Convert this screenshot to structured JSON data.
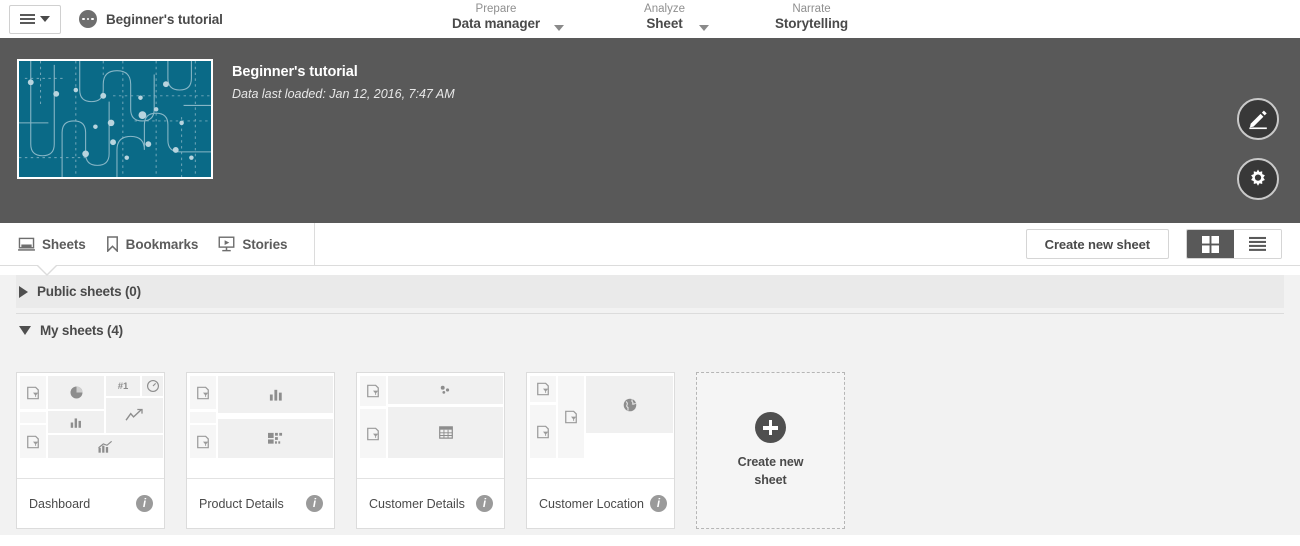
{
  "topnav": {
    "burger_icon": "hamburger-menu-icon",
    "burger_caret_icon": "chevron-down-icon",
    "app_dots_icon": "app-dots-icon",
    "app_label": "Beginner's tutorial",
    "groups": [
      {
        "kicker": "Prepare",
        "title": "Data manager",
        "has_chevron": true
      },
      {
        "kicker": "Analyze",
        "title": "Sheet",
        "has_chevron": true
      },
      {
        "kicker": "Narrate",
        "title": "Storytelling",
        "has_chevron": false
      }
    ]
  },
  "appheader": {
    "thumbnail_alt": "app-thumbnail",
    "thumbnail_color": "#0a6a87",
    "title": "Beginner's tutorial",
    "subtitle": "Data last loaded: Jan 12, 2016, 7:47 AM",
    "edit_icon": "pencil-icon",
    "settings_icon": "gear-icon",
    "background_color": "#595959"
  },
  "tabbar": {
    "tabs": [
      {
        "label": "Sheets",
        "icon": "sheet-icon",
        "active": true
      },
      {
        "label": "Bookmarks",
        "icon": "bookmark-icon",
        "active": false
      },
      {
        "label": "Stories",
        "icon": "story-icon",
        "active": false
      }
    ],
    "create_sheet_label": "Create new sheet",
    "view_grid_icon": "grid-view-icon",
    "view_list_icon": "list-view-icon",
    "active_view": "grid"
  },
  "content": {
    "sections": [
      {
        "label": "Public sheets (0)",
        "expanded": false,
        "toggle_icon": "triangle-right-icon"
      },
      {
        "label": "My sheets (4)",
        "expanded": true,
        "toggle_icon": "triangle-down-icon"
      }
    ],
    "sheets": [
      {
        "title": "Dashboard",
        "info_icon": "info-icon",
        "layout": "dashboard"
      },
      {
        "title": "Product Details",
        "info_icon": "info-icon",
        "layout": "product"
      },
      {
        "title": "Customer Details",
        "info_icon": "info-icon",
        "layout": "customer"
      },
      {
        "title": "Customer Location",
        "info_icon": "info-icon",
        "layout": "location"
      }
    ],
    "create_tile": {
      "label_line1": "Create new",
      "label_line2": "sheet",
      "plus_icon": "plus-circle-icon"
    },
    "preview_icons": {
      "filter": "filter-pane-icon",
      "pie": "pie-chart-icon",
      "bar": "bar-chart-icon",
      "kpi_text": "#1",
      "gauge": "gauge-icon",
      "line": "line-chart-icon",
      "combo": "combo-chart-icon",
      "treemap": "treemap-icon",
      "scatter": "scatter-plot-icon",
      "table": "table-icon",
      "map": "map-globe-icon"
    }
  }
}
